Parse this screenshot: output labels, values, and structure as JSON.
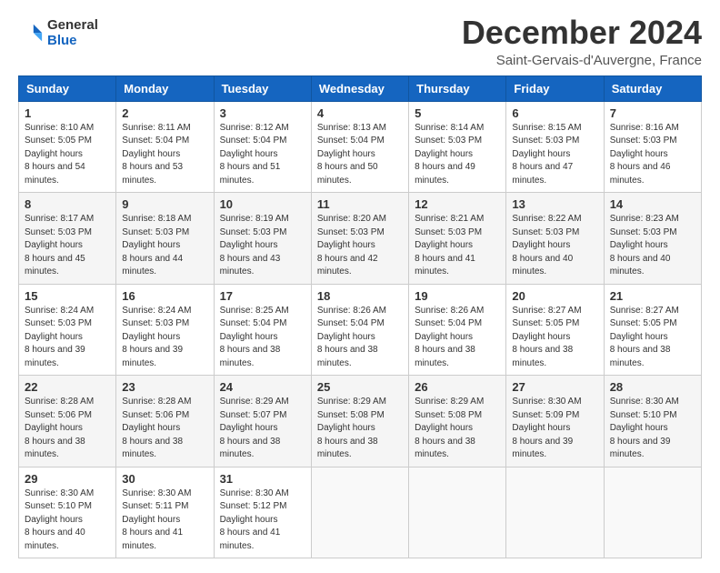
{
  "logo": {
    "general": "General",
    "blue": "Blue"
  },
  "title": "December 2024",
  "subtitle": "Saint-Gervais-d'Auvergne, France",
  "headers": [
    "Sunday",
    "Monday",
    "Tuesday",
    "Wednesday",
    "Thursday",
    "Friday",
    "Saturday"
  ],
  "weeks": [
    [
      {
        "day": "1",
        "sunrise": "8:10 AM",
        "sunset": "5:05 PM",
        "daylight": "8 hours and 54 minutes."
      },
      {
        "day": "2",
        "sunrise": "8:11 AM",
        "sunset": "5:04 PM",
        "daylight": "8 hours and 53 minutes."
      },
      {
        "day": "3",
        "sunrise": "8:12 AM",
        "sunset": "5:04 PM",
        "daylight": "8 hours and 51 minutes."
      },
      {
        "day": "4",
        "sunrise": "8:13 AM",
        "sunset": "5:04 PM",
        "daylight": "8 hours and 50 minutes."
      },
      {
        "day": "5",
        "sunrise": "8:14 AM",
        "sunset": "5:03 PM",
        "daylight": "8 hours and 49 minutes."
      },
      {
        "day": "6",
        "sunrise": "8:15 AM",
        "sunset": "5:03 PM",
        "daylight": "8 hours and 47 minutes."
      },
      {
        "day": "7",
        "sunrise": "8:16 AM",
        "sunset": "5:03 PM",
        "daylight": "8 hours and 46 minutes."
      }
    ],
    [
      {
        "day": "8",
        "sunrise": "8:17 AM",
        "sunset": "5:03 PM",
        "daylight": "8 hours and 45 minutes."
      },
      {
        "day": "9",
        "sunrise": "8:18 AM",
        "sunset": "5:03 PM",
        "daylight": "8 hours and 44 minutes."
      },
      {
        "day": "10",
        "sunrise": "8:19 AM",
        "sunset": "5:03 PM",
        "daylight": "8 hours and 43 minutes."
      },
      {
        "day": "11",
        "sunrise": "8:20 AM",
        "sunset": "5:03 PM",
        "daylight": "8 hours and 42 minutes."
      },
      {
        "day": "12",
        "sunrise": "8:21 AM",
        "sunset": "5:03 PM",
        "daylight": "8 hours and 41 minutes."
      },
      {
        "day": "13",
        "sunrise": "8:22 AM",
        "sunset": "5:03 PM",
        "daylight": "8 hours and 40 minutes."
      },
      {
        "day": "14",
        "sunrise": "8:23 AM",
        "sunset": "5:03 PM",
        "daylight": "8 hours and 40 minutes."
      }
    ],
    [
      {
        "day": "15",
        "sunrise": "8:24 AM",
        "sunset": "5:03 PM",
        "daylight": "8 hours and 39 minutes."
      },
      {
        "day": "16",
        "sunrise": "8:24 AM",
        "sunset": "5:03 PM",
        "daylight": "8 hours and 39 minutes."
      },
      {
        "day": "17",
        "sunrise": "8:25 AM",
        "sunset": "5:04 PM",
        "daylight": "8 hours and 38 minutes."
      },
      {
        "day": "18",
        "sunrise": "8:26 AM",
        "sunset": "5:04 PM",
        "daylight": "8 hours and 38 minutes."
      },
      {
        "day": "19",
        "sunrise": "8:26 AM",
        "sunset": "5:04 PM",
        "daylight": "8 hours and 38 minutes."
      },
      {
        "day": "20",
        "sunrise": "8:27 AM",
        "sunset": "5:05 PM",
        "daylight": "8 hours and 38 minutes."
      },
      {
        "day": "21",
        "sunrise": "8:27 AM",
        "sunset": "5:05 PM",
        "daylight": "8 hours and 38 minutes."
      }
    ],
    [
      {
        "day": "22",
        "sunrise": "8:28 AM",
        "sunset": "5:06 PM",
        "daylight": "8 hours and 38 minutes."
      },
      {
        "day": "23",
        "sunrise": "8:28 AM",
        "sunset": "5:06 PM",
        "daylight": "8 hours and 38 minutes."
      },
      {
        "day": "24",
        "sunrise": "8:29 AM",
        "sunset": "5:07 PM",
        "daylight": "8 hours and 38 minutes."
      },
      {
        "day": "25",
        "sunrise": "8:29 AM",
        "sunset": "5:08 PM",
        "daylight": "8 hours and 38 minutes."
      },
      {
        "day": "26",
        "sunrise": "8:29 AM",
        "sunset": "5:08 PM",
        "daylight": "8 hours and 38 minutes."
      },
      {
        "day": "27",
        "sunrise": "8:30 AM",
        "sunset": "5:09 PM",
        "daylight": "8 hours and 39 minutes."
      },
      {
        "day": "28",
        "sunrise": "8:30 AM",
        "sunset": "5:10 PM",
        "daylight": "8 hours and 39 minutes."
      }
    ],
    [
      {
        "day": "29",
        "sunrise": "8:30 AM",
        "sunset": "5:10 PM",
        "daylight": "8 hours and 40 minutes."
      },
      {
        "day": "30",
        "sunrise": "8:30 AM",
        "sunset": "5:11 PM",
        "daylight": "8 hours and 41 minutes."
      },
      {
        "day": "31",
        "sunrise": "8:30 AM",
        "sunset": "5:12 PM",
        "daylight": "8 hours and 41 minutes."
      },
      null,
      null,
      null,
      null
    ]
  ],
  "labels": {
    "sunrise": "Sunrise:",
    "sunset": "Sunset:",
    "daylight": "Daylight:"
  }
}
